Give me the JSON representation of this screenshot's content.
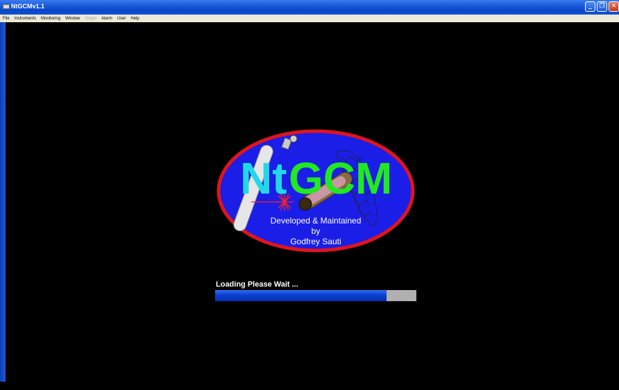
{
  "window": {
    "title": "NtGCMv1.1",
    "controls": {
      "minimize": "_",
      "restore": "❐",
      "close": "✕"
    }
  },
  "menu": {
    "items": [
      {
        "label": "File",
        "enabled": true
      },
      {
        "label": "Instruments",
        "enabled": true
      },
      {
        "label": "Monitoring",
        "enabled": true
      },
      {
        "label": "Window",
        "enabled": true
      },
      {
        "label": "Graph",
        "enabled": false
      },
      {
        "label": "Alarm",
        "enabled": true
      },
      {
        "label": "User",
        "enabled": true
      },
      {
        "label": "Help",
        "enabled": true
      }
    ]
  },
  "splash": {
    "logo_title_part1": "Nt",
    "logo_title_part2": "GCM",
    "credit_line1": "Developed & Maintained",
    "credit_line2": "by",
    "credit_line3": "Godfrey Sauti"
  },
  "loading": {
    "label": "Loading Please Wait ...",
    "progress_fraction": 0.85
  },
  "colors": {
    "title_bar": "#1a5ad8",
    "menu_bg": "#ece9d8",
    "logo_bg": "#1a1ee6",
    "logo_border": "#e0141e",
    "logo_text_cyan": "#22d8e8",
    "logo_text_green": "#22e822",
    "progress_fill": "#0c3fd0",
    "progress_track": "#b0b0b0"
  },
  "icons": [
    "app-icon",
    "minimize-icon",
    "restore-icon",
    "close-icon"
  ]
}
